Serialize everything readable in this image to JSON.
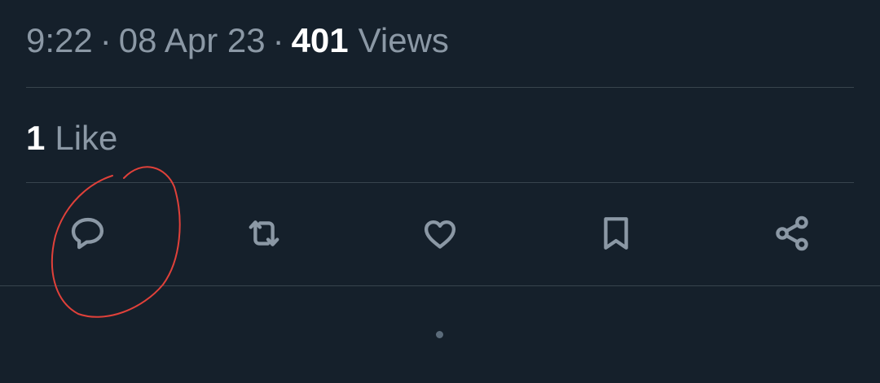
{
  "tweet_meta": {
    "time": "9:22",
    "separator": "·",
    "date": "08 Apr 23",
    "views_count": "401",
    "views_label": "Views"
  },
  "engagement": {
    "likes_count": "1",
    "likes_label": "Like"
  },
  "actions": [
    {
      "name": "reply",
      "icon": "speech-bubble-icon"
    },
    {
      "name": "retweet",
      "icon": "retweet-arrows-icon"
    },
    {
      "name": "like",
      "icon": "heart-icon"
    },
    {
      "name": "bookmark",
      "icon": "bookmark-icon"
    },
    {
      "name": "share",
      "icon": "share-nodes-icon"
    }
  ],
  "colors": {
    "background": "#15202b",
    "primary_text": "#ffffff",
    "secondary_text": "#8b98a5",
    "divider": "#38444d",
    "annotation_ink": "#e0413a"
  }
}
